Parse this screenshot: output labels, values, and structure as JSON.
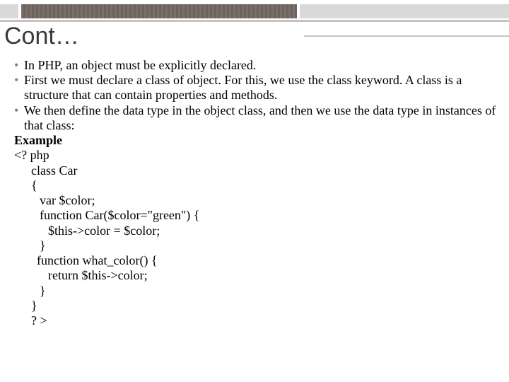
{
  "title": "Cont…",
  "bullets": [
    "In PHP, an object must be explicitly declared.",
    "First we must declare a class of object. For this, we use the class keyword. A class is a structure that can contain properties and methods.",
    "We then define the data type in the object class, and then we use the data type in instances of that class:"
  ],
  "example_label": "Example",
  "code": [
    "<? php",
    "class Car",
    "{",
    "var $color;",
    "function Car($color=\"green\") {",
    "$this->color = $color;",
    "}",
    "function what_color() {",
    "return $this->color;",
    "}",
    "}",
    "? >"
  ]
}
